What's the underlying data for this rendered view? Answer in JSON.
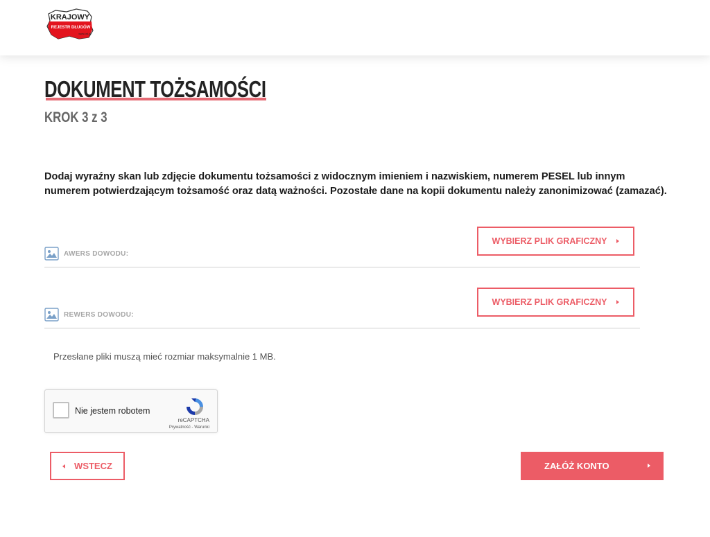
{
  "header": {
    "logo_line1": "KRAJOWY",
    "logo_line2": "REJESTR DŁUGÓW",
    "logo_line3": "www.krd.pl"
  },
  "page": {
    "title": "DOKUMENT TOŻSAMOŚCI",
    "step": "KROK 3 z 3",
    "intro": "Dodaj wyraźny skan lub zdjęcie dokumentu tożsamości z widocznym imieniem i nazwiskiem, numerem PESEL lub innym numerem potwierdzającym tożsamość oraz datą ważności. Pozostałe dane na kopii dokumentu należy zanonimizować (zamazać)."
  },
  "uploads": [
    {
      "label": "AWERS DOWODU:",
      "button_label": "WYBIERZ PLIK GRAFICZNY",
      "icon": "image-icon"
    },
    {
      "label": "REWERS DOWODU:",
      "button_label": "WYBIERZ PLIK GRAFICZNY",
      "icon": "image-icon"
    }
  ],
  "note": "Przesłane pliki muszą mieć rozmiar maksymalnie 1 MB.",
  "captcha": {
    "label": "Nie jestem robotem",
    "brand": "reCAPTCHA",
    "links": "Prywatność - Warunki",
    "checked": false
  },
  "actions": {
    "back_label": "WSTECZ",
    "submit_label": "ZAŁÓŻ KONTO"
  },
  "colors": {
    "accent": "#ec5c66",
    "logo_red": "#e3141e"
  }
}
